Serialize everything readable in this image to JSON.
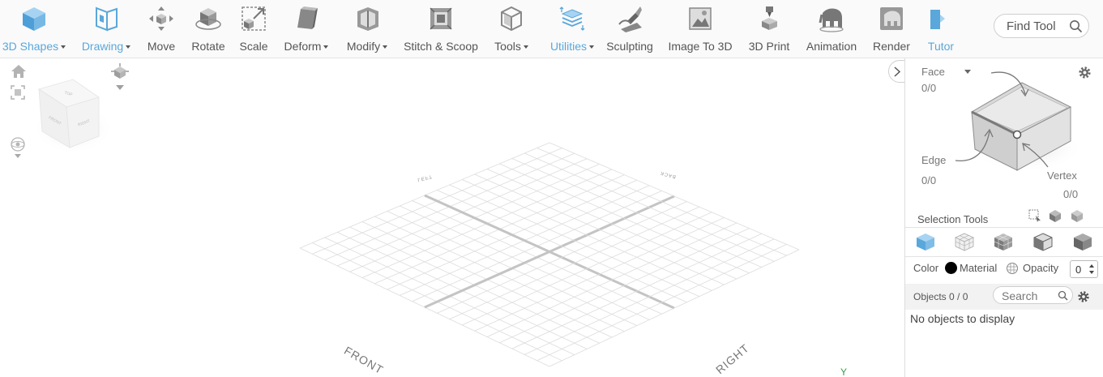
{
  "toolbar": {
    "tools": [
      {
        "label": "3D Shapes",
        "icon": "cube-icon",
        "active": true,
        "dropdown": true
      },
      {
        "label": "Drawing",
        "icon": "drawing-icon",
        "active": true,
        "dropdown": true
      },
      {
        "label": "Move",
        "icon": "move-icon",
        "active": false,
        "dropdown": false
      },
      {
        "label": "Rotate",
        "icon": "rotate-icon",
        "active": false,
        "dropdown": false
      },
      {
        "label": "Scale",
        "icon": "scale-icon",
        "active": false,
        "dropdown": false
      },
      {
        "label": "Deform",
        "icon": "deform-icon",
        "active": false,
        "dropdown": true
      },
      {
        "label": "Modify",
        "icon": "modify-icon",
        "active": false,
        "dropdown": true
      },
      {
        "label": "Stitch & Scoop",
        "icon": "stitch-scoop-icon",
        "active": false,
        "dropdown": false
      },
      {
        "label": "Tools",
        "icon": "tools-icon",
        "active": false,
        "dropdown": true
      },
      {
        "label": "Utilities",
        "icon": "utilities-icon",
        "active": true,
        "dropdown": true
      },
      {
        "label": "Sculpting",
        "icon": "sculpting-icon",
        "active": false,
        "dropdown": false
      },
      {
        "label": "Image To 3D",
        "icon": "image-to-3d-icon",
        "active": false,
        "dropdown": false
      },
      {
        "label": "3D Print",
        "icon": "3d-print-icon",
        "active": false,
        "dropdown": false
      },
      {
        "label": "Animation",
        "icon": "animation-icon",
        "active": false,
        "dropdown": false
      },
      {
        "label": "Render",
        "icon": "render-icon",
        "active": false,
        "dropdown": false
      },
      {
        "label": "Tutor",
        "icon": "tutor-icon",
        "active": true,
        "dropdown": false
      }
    ],
    "find_tool_placeholder": "Find Tool"
  },
  "viewport": {
    "labels": {
      "front": "FRONT",
      "right": "RIGHT",
      "left": "LEFT",
      "back": "BACK",
      "axis_y": "Y"
    },
    "view_cube_faces": {
      "top": "TOP",
      "front": "FRONT",
      "right": "RIGHT"
    }
  },
  "panel": {
    "face_label": "Face",
    "face_count": "0/0",
    "edge_label": "Edge",
    "edge_count": "0/0",
    "vertex_label": "Vertex",
    "vertex_count": "0/0",
    "selection_tools_label": "Selection Tools",
    "color_label": "Color",
    "material_label": "Material",
    "opacity_label": "Opacity",
    "opacity_value": "0",
    "objects_label": "Objects 0 / 0",
    "search_placeholder": "Search",
    "empty_text": "No objects to display",
    "color_swatch": "#000000"
  },
  "colors": {
    "accent": "#5aa7db",
    "icon_gray": "#7a7a7a"
  }
}
